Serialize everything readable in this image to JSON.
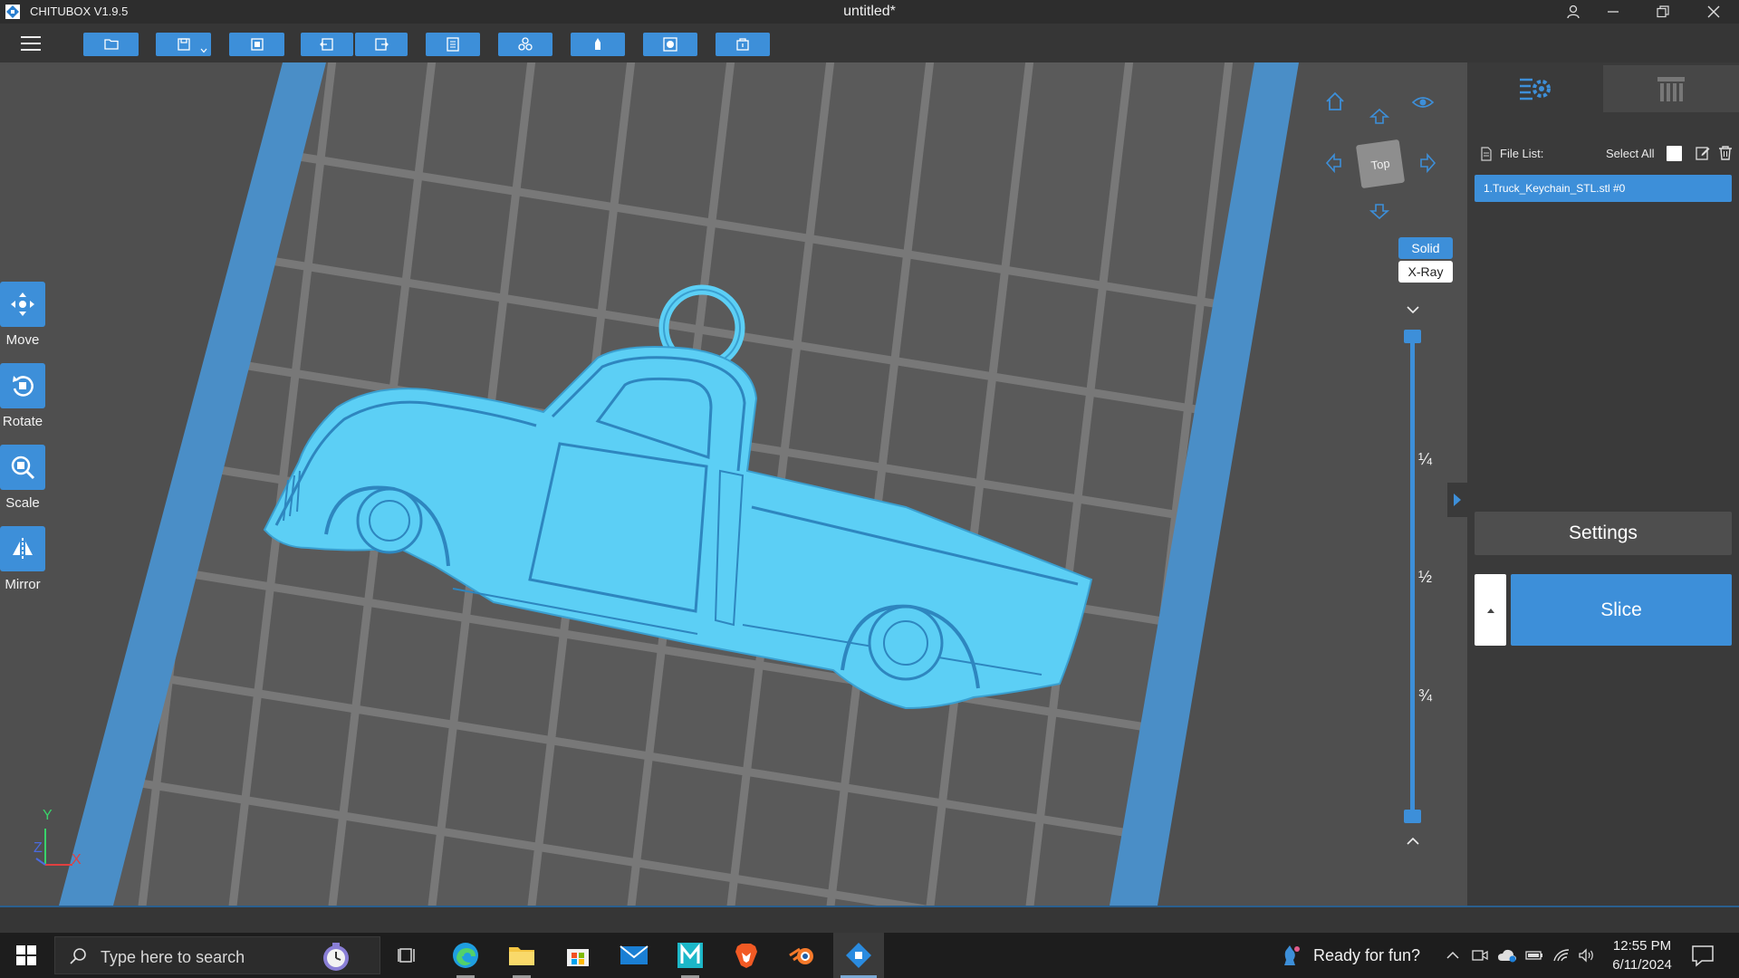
{
  "window": {
    "app_name": "CHITUBOX V1.9.5",
    "doc_title": "untitled*"
  },
  "toolbar": {
    "buttons": [
      "open-file",
      "save",
      "add-model",
      "undo",
      "redo",
      "layout",
      "hollow",
      "support",
      "select",
      "export"
    ]
  },
  "left_tools": [
    {
      "id": "move",
      "label": "Move",
      "icon": "move-icon"
    },
    {
      "id": "rotate",
      "label": "Rotate",
      "icon": "rotate-icon"
    },
    {
      "id": "scale",
      "label": "Scale",
      "icon": "scale-icon"
    },
    {
      "id": "mirror",
      "label": "Mirror",
      "icon": "mirror-icon"
    }
  ],
  "nav_cube": {
    "face": "Top"
  },
  "view_modes": {
    "solid": "Solid",
    "xray": "X-Ray",
    "selected": "Solid"
  },
  "layer_slider": {
    "marks": [
      "¼",
      "½",
      "¾"
    ]
  },
  "axes": {
    "y": "Y",
    "z": "Z",
    "x": "X"
  },
  "right_panel": {
    "file_list_label": "File List:",
    "select_all_label": "Select All",
    "files": [
      "1.Truck_Keychain_STL.stl #0"
    ],
    "settings_label": "Settings",
    "slice_label": "Slice"
  },
  "taskbar": {
    "search_placeholder": "Type here to search",
    "weather_text": "Ready for fun?",
    "time": "12:55 PM",
    "date": "6/11/2024"
  },
  "colors": {
    "accent": "#3d8fd9",
    "model": "#5ccff5",
    "viewport": "#4f4f4f",
    "panel": "#3a3a3a"
  }
}
